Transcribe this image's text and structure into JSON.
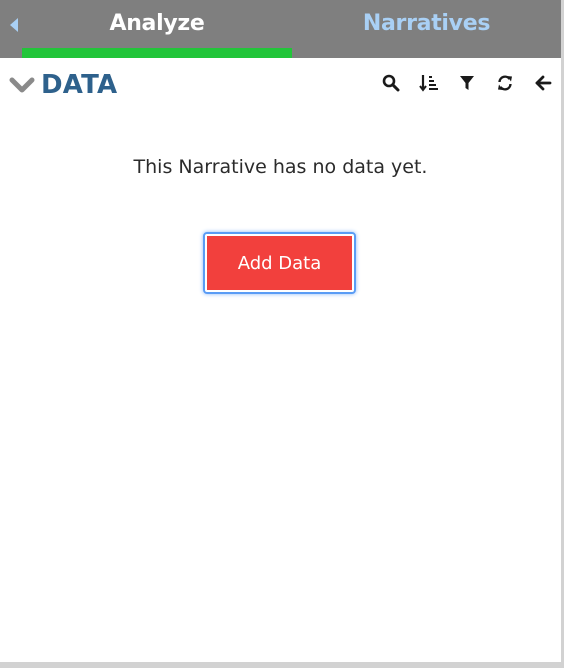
{
  "tabs": [
    {
      "label": "Analyze",
      "active": true
    },
    {
      "label": "Narratives",
      "active": false
    }
  ],
  "colors": {
    "tabbar_bg": "#7f7f7f",
    "active_tab_text": "#ffffff",
    "inactive_tab_text": "#a9d0f5",
    "active_underline": "#22c53a",
    "section_title": "#2e618c",
    "primary_button": "#f2403d"
  },
  "data_panel": {
    "title": "DATA",
    "toolbar_icons": [
      "search-icon",
      "sort-icon",
      "filter-icon",
      "refresh-icon",
      "arrow-left-icon"
    ],
    "empty_message": "This Narrative has no data yet.",
    "add_button_label": "Add Data"
  }
}
